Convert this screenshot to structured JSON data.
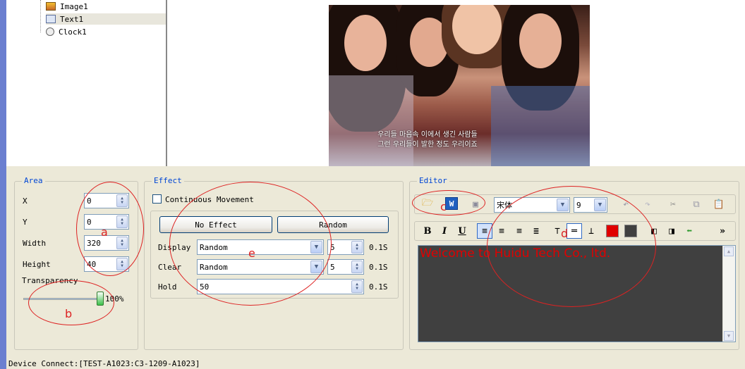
{
  "tree": {
    "items": [
      {
        "label": "Image1",
        "icon": "image-icon"
      },
      {
        "label": "Text1",
        "icon": "text-icon"
      },
      {
        "label": "Clock1",
        "icon": "clock-icon"
      }
    ]
  },
  "preview": {
    "subtitle_line1": "우리들 마음속 이에서 생긴 사람들",
    "subtitle_line2": "그런 우리들이 발한 정도 우리이죠"
  },
  "area": {
    "title": "Area",
    "x_label": "X",
    "x_value": "0",
    "y_label": "Y",
    "y_value": "0",
    "width_label": "Width",
    "width_value": "320",
    "height_label": "Height",
    "height_value": "40",
    "transparency_label": "Transparency",
    "transparency_value": "100%",
    "transparency_level": 1.0
  },
  "effect": {
    "title": "Effect",
    "continuous_label": "Continuous Movement",
    "no_effect_button": "No Effect",
    "random_button": "Random",
    "display_label": "Display",
    "display_value": "Random",
    "display_speed": "5",
    "display_unit": "0.1S",
    "clear_label": "Clear",
    "clear_value": "Random",
    "clear_speed": "5",
    "clear_unit": "0.1S",
    "hold_label": "Hold",
    "hold_value": "50",
    "hold_unit": "0.1S"
  },
  "editor": {
    "title": "Editor",
    "font_value": "宋体",
    "size_value": "9",
    "bold": "B",
    "italic": "I",
    "underline": "U",
    "more": "»",
    "text": "Welcome to Huidu Tech Co., ltd.",
    "text_color": "#e00000",
    "background_color": "#404040"
  },
  "annotations": {
    "a": "a",
    "b": "b",
    "c": "c",
    "d": "d",
    "e": "e"
  },
  "status": {
    "device_connect": "Device Connect:[TEST-A1023:C3-1209-A1023]"
  }
}
